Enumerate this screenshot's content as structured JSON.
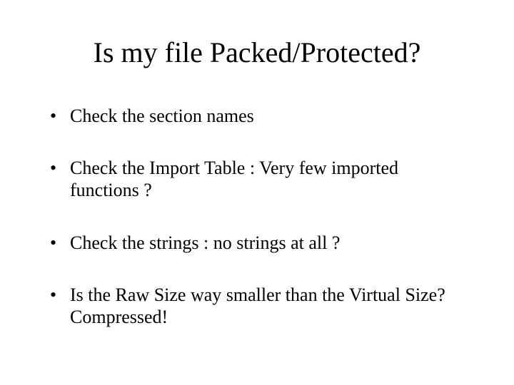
{
  "title": "Is my file Packed/Protected?",
  "bullets": [
    "Check the section names",
    "Check the Import Table : Very few imported functions ?",
    "Check the strings : no strings at all ?",
    "Is the Raw Size way smaller than the Virtual Size?  Compressed!"
  ]
}
